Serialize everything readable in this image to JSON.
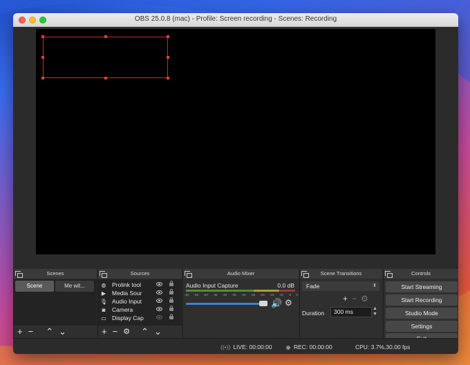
{
  "window": {
    "title": "OBS 25.0.8 (mac) - Profile: Screen recording - Scenes: Recording"
  },
  "docks": {
    "scenes": {
      "title": "Scenes",
      "items": [
        {
          "label": "Scene",
          "selected": true
        },
        {
          "label": "Me wit..."
        }
      ],
      "footer": {
        "add": "+",
        "remove": "−",
        "up": "⌃",
        "down": "⌄"
      }
    },
    "sources": {
      "title": "Sources",
      "items": [
        {
          "label": "Prolink tool",
          "icon": "globe-icon",
          "icon_glyph": "◍",
          "visible": true
        },
        {
          "label": "Media Sour",
          "icon": "play-icon",
          "icon_glyph": "▶",
          "visible": true
        },
        {
          "label": "Audio Input",
          "icon": "microphone-icon",
          "icon_glyph": "🎙",
          "visible": true
        },
        {
          "label": "Camera",
          "icon": "camera-icon",
          "icon_glyph": "◙",
          "visible": true
        },
        {
          "label": "Display Cap",
          "icon": "monitor-icon",
          "icon_glyph": "▭",
          "visible": false
        }
      ],
      "footer": {
        "add": "+",
        "remove": "−",
        "settings": "⚙",
        "up": "⌃",
        "down": "⌄"
      }
    },
    "audio_mixer": {
      "title": "Audio Mixer",
      "channel_name": "Audio Input Capture",
      "level": "0.0 dB",
      "ticks": [
        "-60",
        "-55",
        "-50",
        "-45",
        "-40",
        "-35",
        "-30",
        "-25",
        "-20",
        "-15",
        "-10",
        "-5",
        "0"
      ]
    },
    "scene_transitions": {
      "title": "Scene Transitions",
      "selected": "Fade",
      "add": "+",
      "remove": "−",
      "settings": "⚙",
      "duration_label": "Duration",
      "duration_value": "300 ms"
    },
    "controls": {
      "title": "Controls",
      "buttons": [
        "Start Streaming",
        "Start Recording",
        "Studio Mode",
        "Settings",
        "Exit"
      ]
    }
  },
  "status": {
    "live": "LIVE: 00:00:00",
    "rec": "REC: 00:00:00",
    "cpu": "CPU: 3.7%,30.00 fps"
  },
  "colors": {
    "selection": "#d12a2a",
    "slider": "#3b82d6"
  }
}
